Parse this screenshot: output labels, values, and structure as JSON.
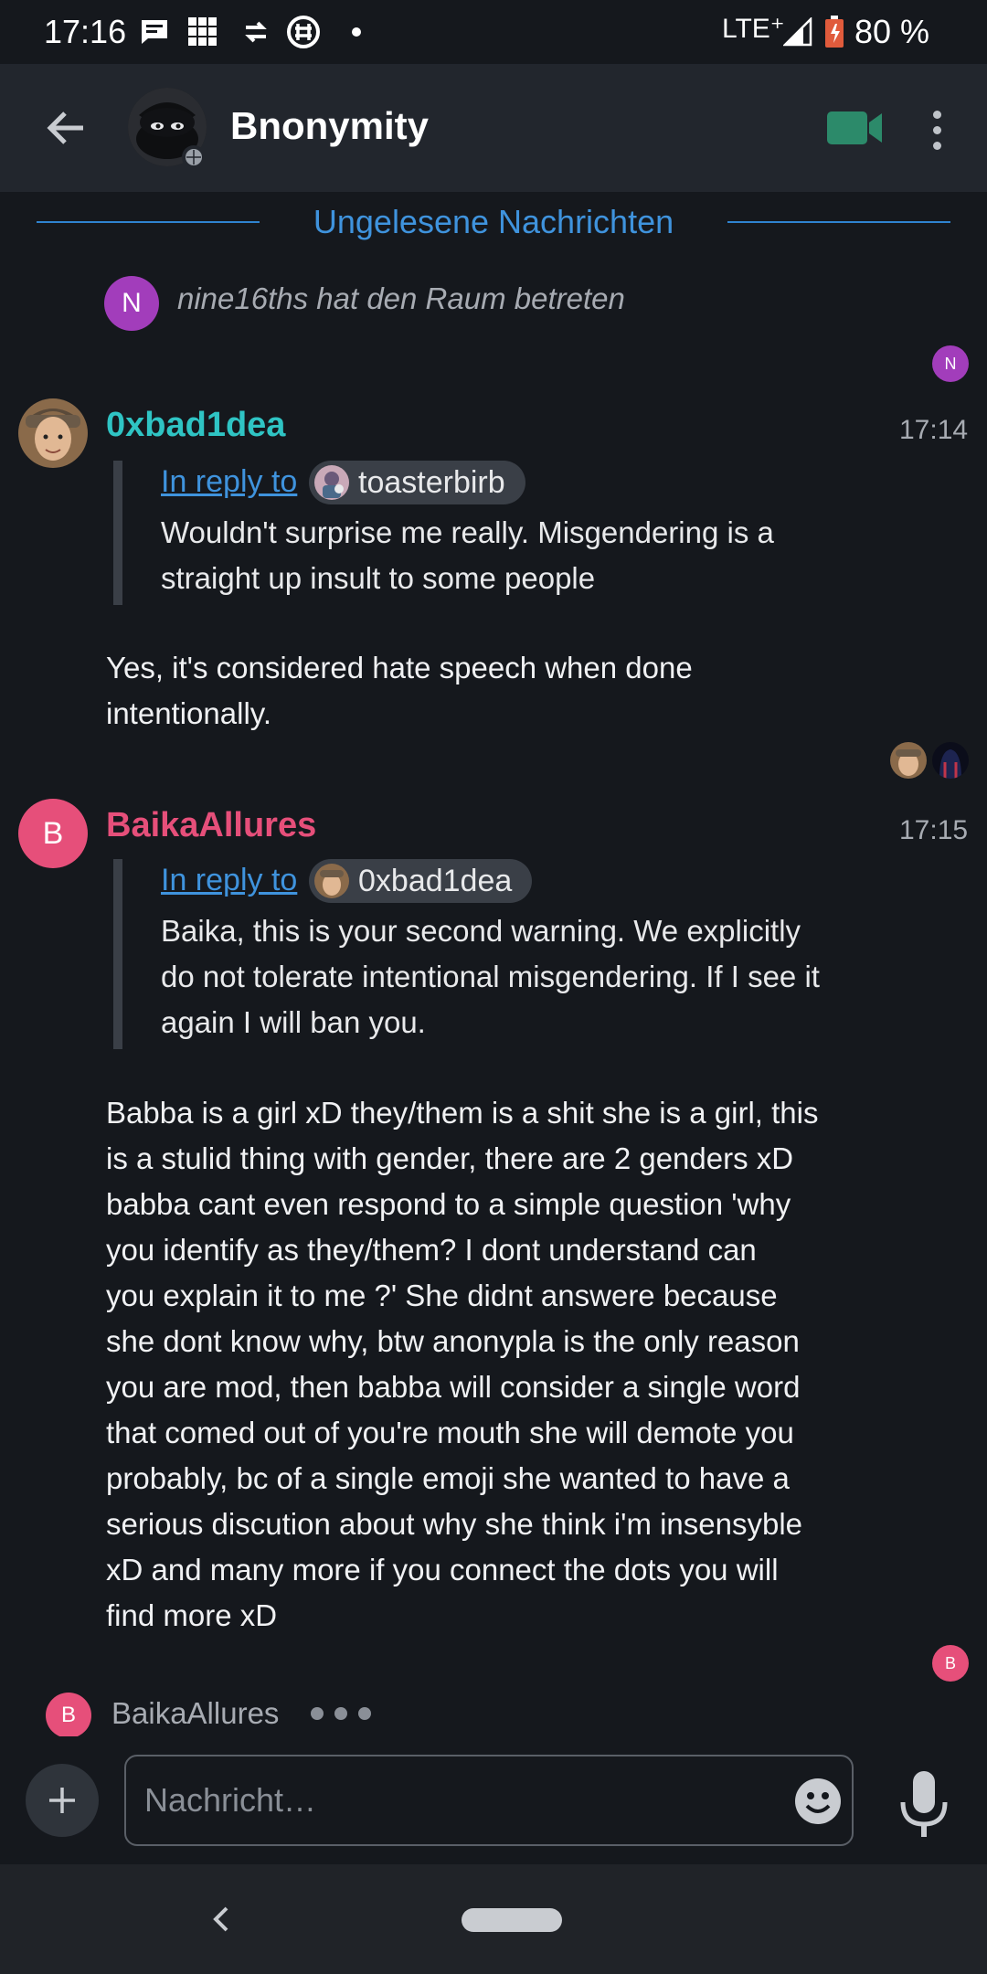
{
  "status_bar": {
    "time": "17:16",
    "network": "LTE⁺",
    "battery": "80 %"
  },
  "toolbar": {
    "room_name": "Bnonymity"
  },
  "timeline": {
    "unread_divider": "Ungelesene Nachrichten",
    "member_event": {
      "avatar_letter": "N",
      "text": "nine16ths hat den Raum betreten",
      "receipt_letter": "N"
    },
    "messages": [
      {
        "sender": "0xbad1dea",
        "sender_color": "#2fc4c4",
        "time": "17:14",
        "reply_label": "In reply to",
        "reply_to": "toasterbirb",
        "quote_lines": [
          "Wouldn't surprise me really. Misgendering is a",
          "straight up insult to some people"
        ],
        "body_lines": [
          "Yes, it's considered hate speech when done",
          "intentionally."
        ]
      },
      {
        "sender": "BaikaAllures",
        "sender_color": "#e64f7a",
        "avatar_letter": "B",
        "time": "17:15",
        "reply_label": "In reply to",
        "reply_to": "0xbad1dea",
        "quote_lines": [
          "Baika, this is your second warning. We explicitly",
          "do not tolerate intentional misgendering. If I see it",
          "again I will ban you."
        ],
        "body_lines": [
          "Babba is a girl xD they/them is a shit she is a girl, this",
          "is a stulid thing with gender, there are 2 genders xD",
          "babba cant even respond to a simple question 'why",
          "you identify as they/them? I dont understand can",
          "you explain it to me ?' She didnt answere because",
          "she dont know why, btw anonypla is the only reason",
          "you are mod, then babba will consider a single word",
          "that comed out of you're mouth she will demote you",
          "probably, bc of a single emoji she wanted to have a",
          "serious discution about why she think i'm insensyble",
          "xD and many more if you connect the dots you will",
          "find more xD"
        ],
        "receipt_letter": "B"
      }
    ],
    "typing": {
      "avatar_letter": "B",
      "name": "BaikaAllures"
    }
  },
  "composer": {
    "placeholder": "Nachricht…"
  },
  "icons": {
    "back": "arrow-left-icon",
    "video": "video-camera-icon",
    "more": "more-vertical-icon",
    "attach": "plus-icon",
    "emoji": "emoji-icon",
    "mic": "microphone-icon"
  },
  "colors": {
    "background": "#15181d",
    "toolbar": "#22262d",
    "accent": "#3f93dd",
    "video_icon": "#2c8a6a"
  }
}
